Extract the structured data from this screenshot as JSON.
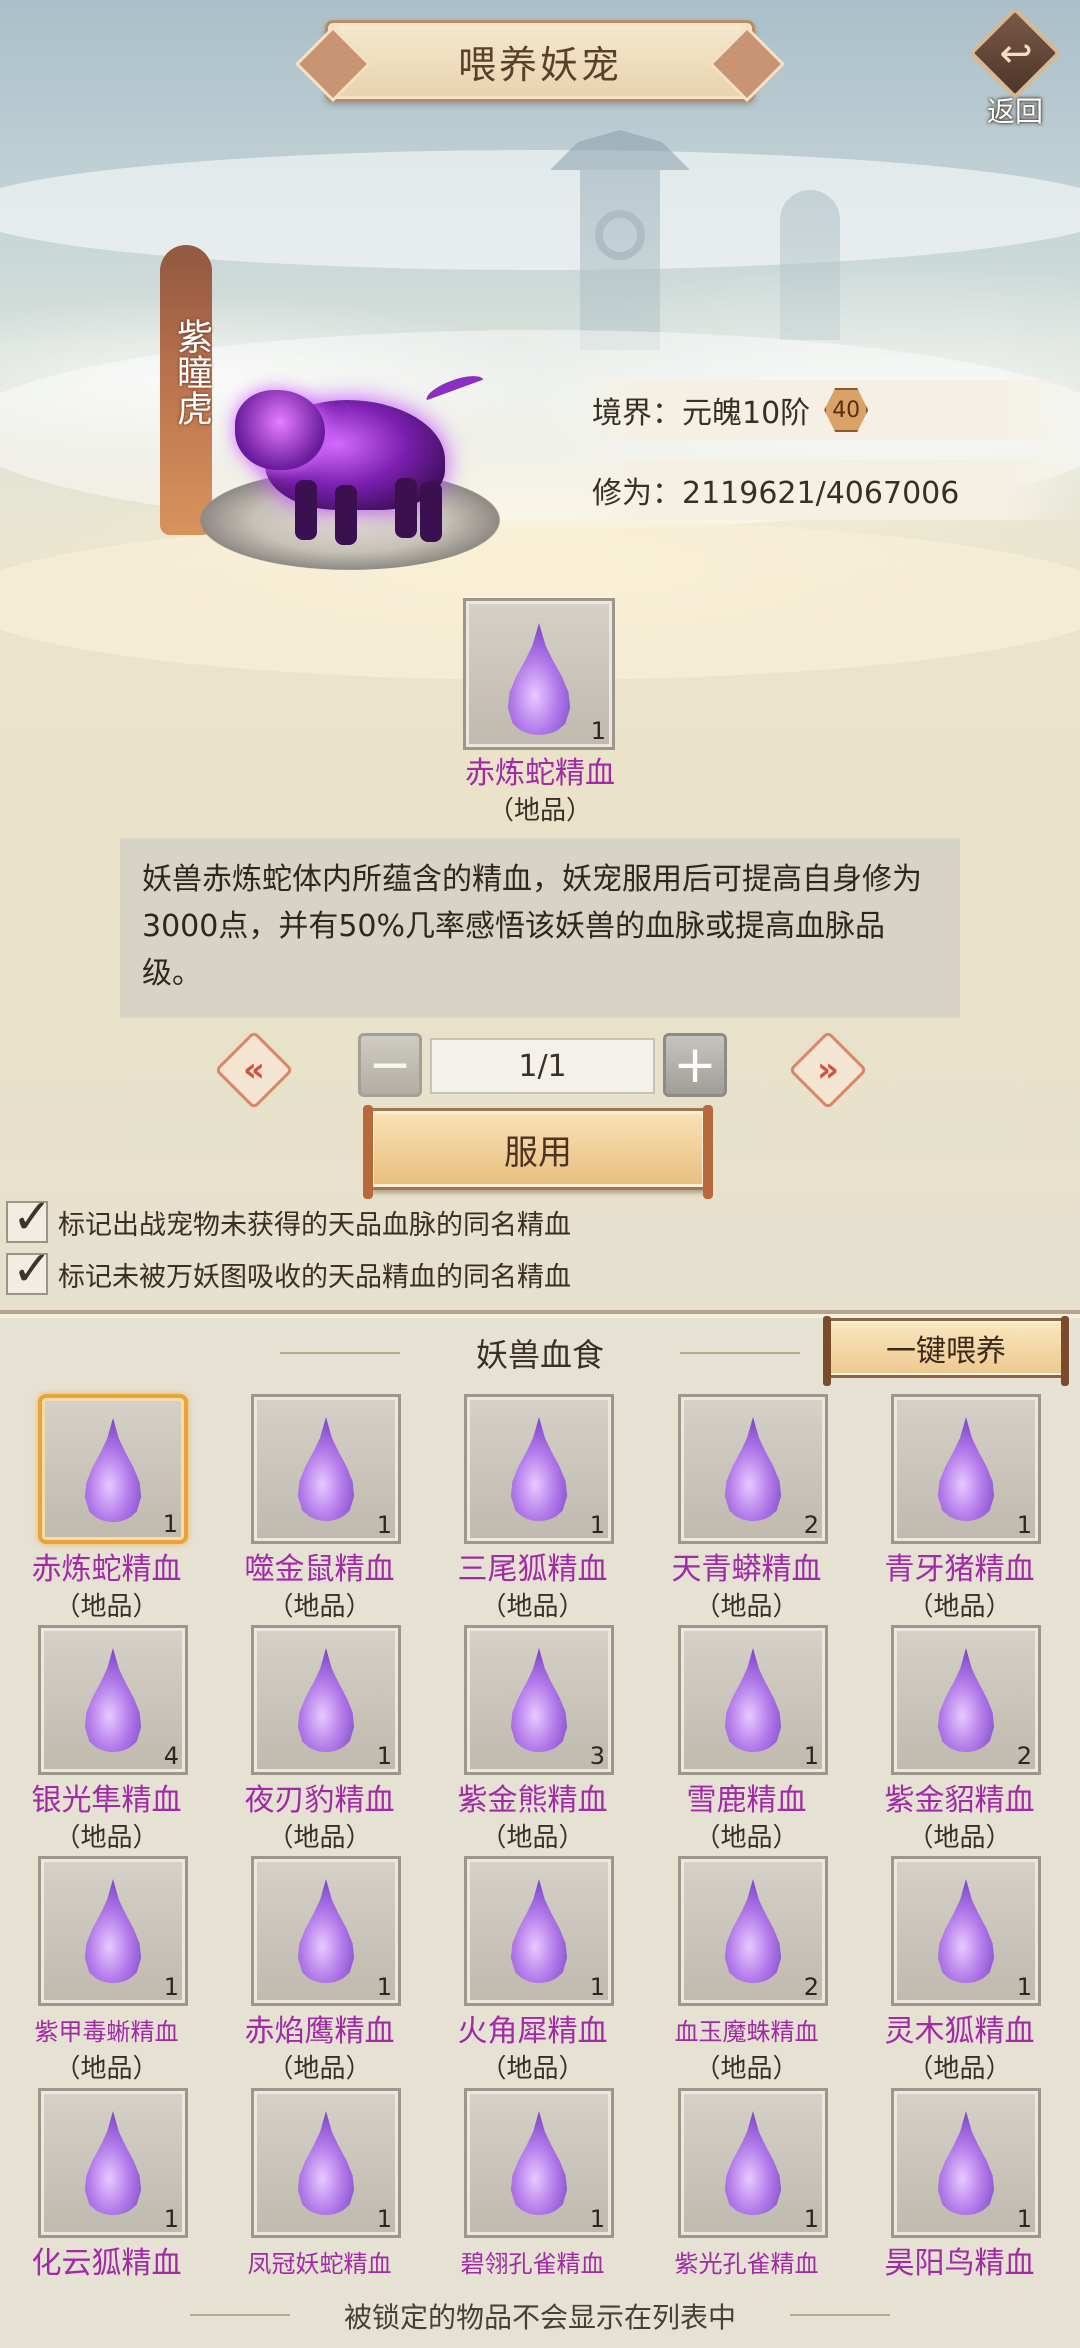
{
  "header": {
    "title": "喂养妖宠",
    "back_label": "返回"
  },
  "pet": {
    "name": "紫瞳虎",
    "realm_label": "境界：元魄10阶",
    "level": "40",
    "cultivation_label": "修为：2119621/4067006"
  },
  "selected_item": {
    "name": "赤炼蛇精血",
    "grade": "（地品）",
    "count": "1",
    "description": "妖兽赤炼蛇体内所蕴含的精血，妖宠服用后可提高自身修为3000点，并有50%几率感悟该妖兽的血脉或提高血脉品级。"
  },
  "quantity": {
    "value": "1/1",
    "minus_symbol": "−",
    "plus_symbol": "+",
    "prev_symbol": "«",
    "next_symbol": "»"
  },
  "use_button_label": "服用",
  "checkboxes": [
    {
      "label": "标记出战宠物未获得的天品血脉的同名精血",
      "checked": true
    },
    {
      "label": "标记未被万妖图吸收的天品精血的同名精血",
      "checked": true
    }
  ],
  "panel": {
    "title": "妖兽血食",
    "feed_all_label": "一键喂养",
    "footer_note": "被锁定的物品不会显示在列表中"
  },
  "items": [
    {
      "name": "赤炼蛇精血",
      "grade": "（地品）",
      "count": "1",
      "selected": true
    },
    {
      "name": "噬金鼠精血",
      "grade": "（地品）",
      "count": "1"
    },
    {
      "name": "三尾狐精血",
      "grade": "（地品）",
      "count": "1"
    },
    {
      "name": "天青蟒精血",
      "grade": "（地品）",
      "count": "2"
    },
    {
      "name": "青牙猪精血",
      "grade": "（地品）",
      "count": "1"
    },
    {
      "name": "银光隼精血",
      "grade": "（地品）",
      "count": "4"
    },
    {
      "name": "夜刃豹精血",
      "grade": "（地品）",
      "count": "1"
    },
    {
      "name": "紫金熊精血",
      "grade": "（地品）",
      "count": "3"
    },
    {
      "name": "雪鹿精血",
      "grade": "（地品）",
      "count": "1"
    },
    {
      "name": "紫金貂精血",
      "grade": "（地品）",
      "count": "2"
    },
    {
      "name": "紫甲毒蜥精血",
      "grade": "（地品）",
      "count": "1",
      "small": true
    },
    {
      "name": "赤焰鹰精血",
      "grade": "（地品）",
      "count": "1"
    },
    {
      "name": "火角犀精血",
      "grade": "（地品）",
      "count": "1"
    },
    {
      "name": "血玉魔蛛精血",
      "grade": "（地品）",
      "count": "2",
      "small": true
    },
    {
      "name": "灵木狐精血",
      "grade": "（地品）",
      "count": "1"
    },
    {
      "name": "化云狐精血",
      "grade": "",
      "count": "1"
    },
    {
      "name": "凤冠妖蛇精血",
      "grade": "",
      "count": "1",
      "small": true
    },
    {
      "name": "碧翎孔雀精血",
      "grade": "",
      "count": "1",
      "small": true
    },
    {
      "name": "紫光孔雀精血",
      "grade": "",
      "count": "1",
      "small": true
    },
    {
      "name": "昊阳鸟精血",
      "grade": "",
      "count": "1"
    }
  ],
  "colors": {
    "item_name": "#a22aa6",
    "selected_border": "#e8a43a",
    "button_gold": "#edc88f"
  },
  "icons": {
    "item": "purple-blood-drop-icon",
    "back": "back-arrow-icon",
    "check": "checkmark-icon"
  }
}
